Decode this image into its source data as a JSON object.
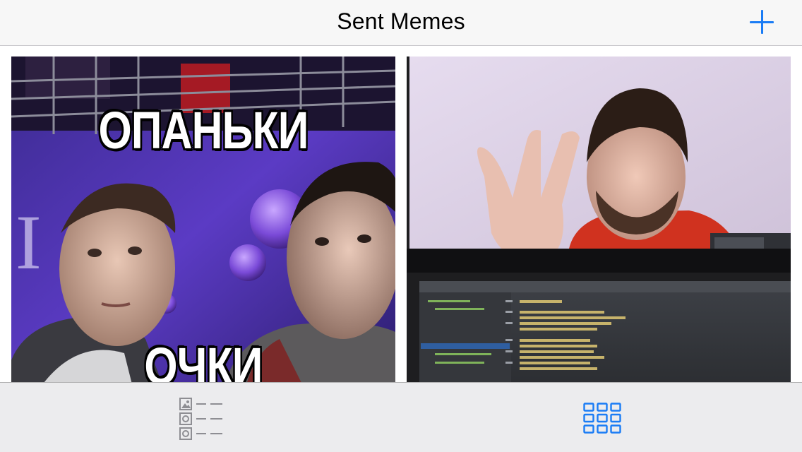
{
  "navbar": {
    "title": "Sent Memes",
    "add_icon": "plus-icon",
    "accent": "#1a7cf5"
  },
  "memes": [
    {
      "top_text": "ОПАНЬКИ",
      "bottom_text": "ОЧКИ"
    },
    {
      "top_text": "",
      "bottom_text": ""
    }
  ],
  "tabbar": {
    "tabs": [
      {
        "icon": "table-list-icon",
        "selected": false,
        "tint": "#8e8e93"
      },
      {
        "icon": "collection-grid-icon",
        "selected": true,
        "tint": "#1a7cf5"
      }
    ]
  }
}
